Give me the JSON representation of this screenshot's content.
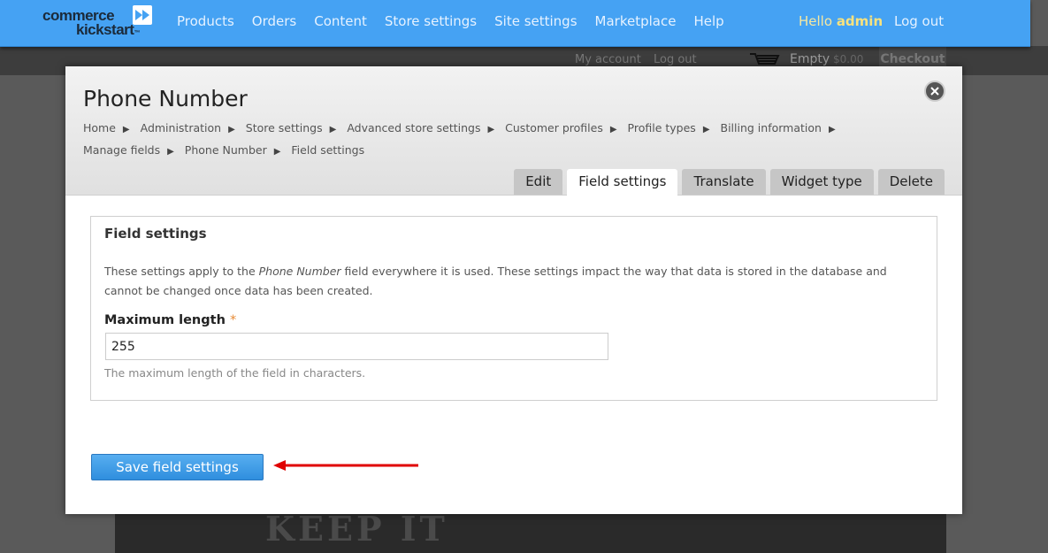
{
  "site": {
    "logo_line1": "commerce",
    "logo_line2": "kickstart",
    "nav": [
      "Products",
      "Orders",
      "Content",
      "Store settings",
      "Site settings",
      "Marketplace",
      "Help"
    ],
    "hello_prefix": "Hello",
    "hello_user": "admin",
    "logout": "Log out",
    "secondary_links": [
      "My account",
      "Log out"
    ],
    "cart_status": "Empty",
    "cart_amount": "$0.00",
    "checkout": "Checkout",
    "hero_text": "KEEP IT",
    "colors": {
      "topbar": "#45a2f3",
      "accent_orange": "#e88a35",
      "arrow_red": "#e00000"
    }
  },
  "modal": {
    "title": "Phone Number",
    "close_icon": "close-icon",
    "breadcrumb": [
      "Home",
      "Administration",
      "Store settings",
      "Advanced store settings",
      "Customer profiles",
      "Profile types",
      "Billing information",
      "Manage fields",
      "Phone Number",
      "Field settings"
    ],
    "tabs": [
      {
        "label": "Edit",
        "active": false
      },
      {
        "label": "Field settings",
        "active": true
      },
      {
        "label": "Translate",
        "active": false
      },
      {
        "label": "Widget type",
        "active": false
      },
      {
        "label": "Delete",
        "active": false
      }
    ],
    "fieldset": {
      "legend": "Field settings",
      "desc_before": "These settings apply to the",
      "desc_field": "Phone Number",
      "desc_after": "field everywhere it is used. These settings impact the way that data is stored in the database and cannot be changed once data has been created.",
      "label": "Maximum length",
      "required_mark": "*",
      "value": "255",
      "help": "The maximum length of the field in characters."
    },
    "save_button": "Save field settings"
  }
}
